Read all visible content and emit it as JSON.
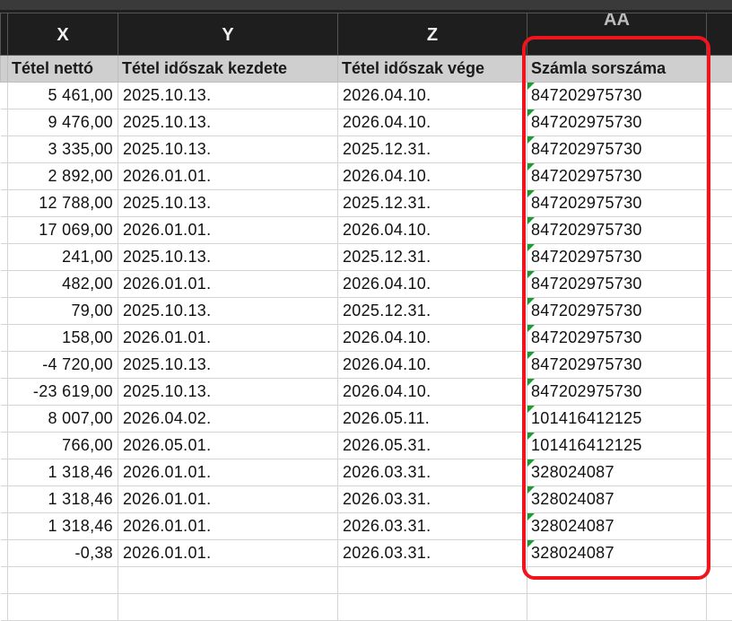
{
  "columns": [
    "X",
    "Y",
    "Z",
    "AA"
  ],
  "headers": {
    "net": "Tétel nettó",
    "period_start": "Tétel időszak kezdete",
    "period_end": "Tétel időszak vége",
    "invoice_no": "Számla sorszáma"
  },
  "rows": [
    {
      "net": "5 461,00",
      "start": "2025.10.13.",
      "end": "2026.04.10.",
      "invoice": "847202975730"
    },
    {
      "net": "9 476,00",
      "start": "2025.10.13.",
      "end": "2026.04.10.",
      "invoice": "847202975730"
    },
    {
      "net": "3 335,00",
      "start": "2025.10.13.",
      "end": "2025.12.31.",
      "invoice": "847202975730"
    },
    {
      "net": "2 892,00",
      "start": "2026.01.01.",
      "end": "2026.04.10.",
      "invoice": "847202975730"
    },
    {
      "net": "12 788,00",
      "start": "2025.10.13.",
      "end": "2025.12.31.",
      "invoice": "847202975730"
    },
    {
      "net": "17 069,00",
      "start": "2026.01.01.",
      "end": "2026.04.10.",
      "invoice": "847202975730"
    },
    {
      "net": "241,00",
      "start": "2025.10.13.",
      "end": "2025.12.31.",
      "invoice": "847202975730"
    },
    {
      "net": "482,00",
      "start": "2026.01.01.",
      "end": "2026.04.10.",
      "invoice": "847202975730"
    },
    {
      "net": "79,00",
      "start": "2025.10.13.",
      "end": "2025.12.31.",
      "invoice": "847202975730"
    },
    {
      "net": "158,00",
      "start": "2026.01.01.",
      "end": "2026.04.10.",
      "invoice": "847202975730"
    },
    {
      "net": "-4 720,00",
      "start": "2025.10.13.",
      "end": "2026.04.10.",
      "invoice": "847202975730"
    },
    {
      "net": "-23 619,00",
      "start": "2025.10.13.",
      "end": "2026.04.10.",
      "invoice": "847202975730"
    },
    {
      "net": "8 007,00",
      "start": "2026.04.02.",
      "end": "2026.05.11.",
      "invoice": "101416412125"
    },
    {
      "net": "766,00",
      "start": "2026.05.01.",
      "end": "2026.05.31.",
      "invoice": "101416412125"
    },
    {
      "net": "1 318,46",
      "start": "2026.01.01.",
      "end": "2026.03.31.",
      "invoice": "328024087"
    },
    {
      "net": "1 318,46",
      "start": "2026.01.01.",
      "end": "2026.03.31.",
      "invoice": "328024087"
    },
    {
      "net": "1 318,46",
      "start": "2026.01.01.",
      "end": "2026.03.31.",
      "invoice": "328024087"
    },
    {
      "net": "-0,38",
      "start": "2026.01.01.",
      "end": "2026.03.31.",
      "invoice": "328024087"
    }
  ],
  "colors": {
    "column_header_bg": "#1e1e1e",
    "field_header_bg": "#cfcfcf",
    "comment_flag": "#1f9b33",
    "highlight_box": "#f0141e"
  },
  "icons": {
    "cell_flag": "green-triangle-indicator"
  }
}
